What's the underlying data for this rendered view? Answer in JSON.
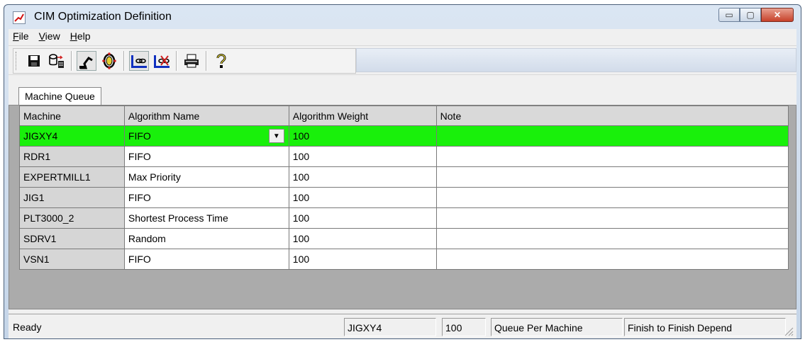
{
  "window": {
    "title": "CIM Optimization Definition",
    "controls": {
      "minimize": "▭",
      "maximize": "▢",
      "close": "✕"
    }
  },
  "menu": [
    {
      "label_u": "F",
      "label_rest": "ile"
    },
    {
      "label_u": "V",
      "label_rest": "iew"
    },
    {
      "label_u": "H",
      "label_rest": "elp"
    }
  ],
  "toolbar": {
    "icons": [
      "save-icon",
      "database-export-icon",
      "robot-arm-icon",
      "ring-icon",
      "link-icon",
      "unlink-icon",
      "print-icon",
      "help-icon"
    ]
  },
  "tab": {
    "label": "Machine Queue"
  },
  "grid": {
    "columns": [
      "Machine",
      "Algorithm Name",
      "Algorithm Weight",
      "Note"
    ],
    "rows": [
      {
        "machine": "JIGXY4",
        "algorithm": "FIFO",
        "weight": "100",
        "note": ""
      },
      {
        "machine": "RDR1",
        "algorithm": "FIFO",
        "weight": "100",
        "note": ""
      },
      {
        "machine": "EXPERTMILL1",
        "algorithm": "Max Priority",
        "weight": "100",
        "note": ""
      },
      {
        "machine": "JIG1",
        "algorithm": "FIFO",
        "weight": "100",
        "note": ""
      },
      {
        "machine": "PLT3000_2",
        "algorithm": "Shortest Process Time",
        "weight": "100",
        "note": ""
      },
      {
        "machine": "SDRV1",
        "algorithm": "Random",
        "weight": "100",
        "note": ""
      },
      {
        "machine": "VSN1",
        "algorithm": "FIFO",
        "weight": "100",
        "note": ""
      }
    ],
    "selected_color": "#19f00b"
  },
  "status": {
    "ready": "Ready",
    "machine": "JIGXY4",
    "weight": "100",
    "mode": "Queue Per Machine",
    "dependency": "Finish to Finish Depend"
  }
}
